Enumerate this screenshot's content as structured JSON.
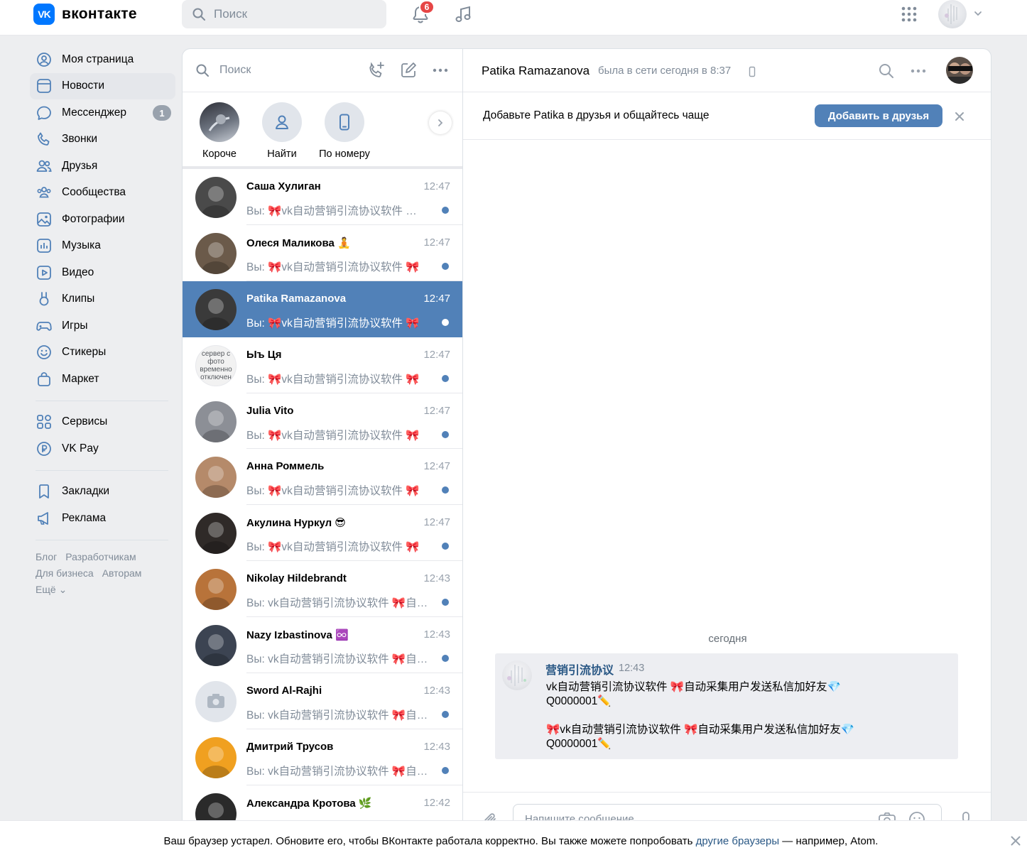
{
  "header": {
    "logo_mark": "VK",
    "logo_text": "вконтакте",
    "search_placeholder": "Поиск",
    "notifications_count": "6"
  },
  "sidebar": {
    "items": [
      {
        "label": "Моя страница",
        "icon": "user-circle-icon"
      },
      {
        "label": "Новости",
        "icon": "news-icon"
      },
      {
        "label": "Мессенджер",
        "icon": "message-icon",
        "badge": "1"
      },
      {
        "label": "Звонки",
        "icon": "phone-icon"
      },
      {
        "label": "Друзья",
        "icon": "friends-icon"
      },
      {
        "label": "Сообщества",
        "icon": "groups-icon"
      },
      {
        "label": "Фотографии",
        "icon": "photo-icon"
      },
      {
        "label": "Музыка",
        "icon": "music-icon"
      },
      {
        "label": "Видео",
        "icon": "video-icon"
      },
      {
        "label": "Клипы",
        "icon": "clips-icon"
      },
      {
        "label": "Игры",
        "icon": "gamepad-icon"
      },
      {
        "label": "Стикеры",
        "icon": "smile-icon"
      },
      {
        "label": "Маркет",
        "icon": "bag-icon"
      }
    ],
    "items2": [
      {
        "label": "Сервисы",
        "icon": "services-icon"
      },
      {
        "label": "VK Pay",
        "icon": "vkpay-icon"
      }
    ],
    "items3": [
      {
        "label": "Закладки",
        "icon": "bookmark-icon"
      },
      {
        "label": "Реклама",
        "icon": "megaphone-icon"
      }
    ],
    "footer": {
      "blog": "Блог",
      "developers": "Разработчикам",
      "business": "Для бизнеса",
      "authors": "Авторам",
      "more": "Ещё"
    }
  },
  "conversations": {
    "search_placeholder": "Поиск",
    "stories": [
      {
        "label": "Короче"
      },
      {
        "label": "Найти"
      },
      {
        "label": "По номеру"
      }
    ],
    "list": [
      {
        "name": "Саша Хулиган",
        "time": "12:47",
        "preview": "Вы: 🎀vk自动营销引流协议软件 🎀自动采集用户发送私信加好友",
        "avatar": "#4a4a4a"
      },
      {
        "name": "Олеся Маликова 🧘",
        "time": "12:47",
        "preview": "Вы: 🎀vk自动营销引流协议软件 🎀",
        "avatar": "#6b5a4a"
      },
      {
        "name": "Patika Ramazanova",
        "time": "12:47",
        "preview": "Вы: 🎀vk自动营销引流协议软件 🎀",
        "avatar": "#3a3a3a"
      },
      {
        "name": "Ыъ Ця",
        "time": "12:47",
        "preview": "Вы: 🎀vk自动营销引流协议软件 🎀",
        "avatar": "#f2f2f2",
        "avatar_text": "сервер с фото временно отключен"
      },
      {
        "name": "Julia Vito",
        "time": "12:47",
        "preview": "Вы: 🎀vk自动营销引流协议软件 🎀",
        "avatar": "#8c8f96"
      },
      {
        "name": "Анна Роммель",
        "time": "12:47",
        "preview": "Вы: 🎀vk自动营销引流协议软件 🎀",
        "avatar": "#b58a6a"
      },
      {
        "name": "Акулина Нуркул 😎",
        "time": "12:47",
        "preview": "Вы: 🎀vk自动营销引流协议软件 🎀",
        "avatar": "#2f2a28"
      },
      {
        "name": "Nikolay Hildebrandt",
        "time": "12:43",
        "preview": "Вы: vk自动营销引流协议软件 🎀自动采集用户发送私信加好友",
        "avatar": "#b8733a"
      },
      {
        "name": "Nazy Izbastinova ♾️",
        "time": "12:43",
        "preview": "Вы: vk自动营销引流协议软件 🎀自动采集用户发送私信加好友",
        "avatar": "#3c4452"
      },
      {
        "name": "Sword Al-Rajhi",
        "time": "12:43",
        "preview": "Вы: vk自动营销引流协议软件 🎀自动采集用户发送私信加好友",
        "avatar": "#e1e5eb"
      },
      {
        "name": "Дмитрий Трусов",
        "time": "12:43",
        "preview": "Вы: vk自动营销引流协议软件 🎀自动采集用户发送私信加好友",
        "avatar": "#f0a020"
      },
      {
        "name": "Александра Кротова 🌿",
        "time": "12:42",
        "preview": "",
        "avatar": "#2a2a2a"
      }
    ]
  },
  "chat": {
    "name": "Patika Ramazanova",
    "status": "была в сети сегодня в 8:37",
    "add_friend_text": "Добавьте Patika в друзья и общайтесь чаще",
    "add_friend_button": "Добавить в друзья",
    "day_label": "сегодня",
    "message": {
      "author": "营销引流协议",
      "time": "12:43",
      "line1": "vk自动营销引流协议软件 🎀自动采集用户发送私信加好友💎",
      "line2": "Q0000001✏️",
      "line3": "🎀vk自动营销引流协议软件 🎀自动采集用户发送私信加好友💎",
      "line4": "Q0000001✏️"
    },
    "compose_placeholder": "Напишите сообщение..."
  },
  "banner": {
    "text_before": "Ваш браузер устарел. Обновите его, чтобы ВКонтакте работала корректно. Вы также можете попробовать ",
    "link": "другие браузеры",
    "text_after": " — например, Atom."
  },
  "colors": {
    "accent": "#5181b8",
    "brand": "#0077ff",
    "badge_red": "#e64646",
    "bg": "#edeef0"
  }
}
